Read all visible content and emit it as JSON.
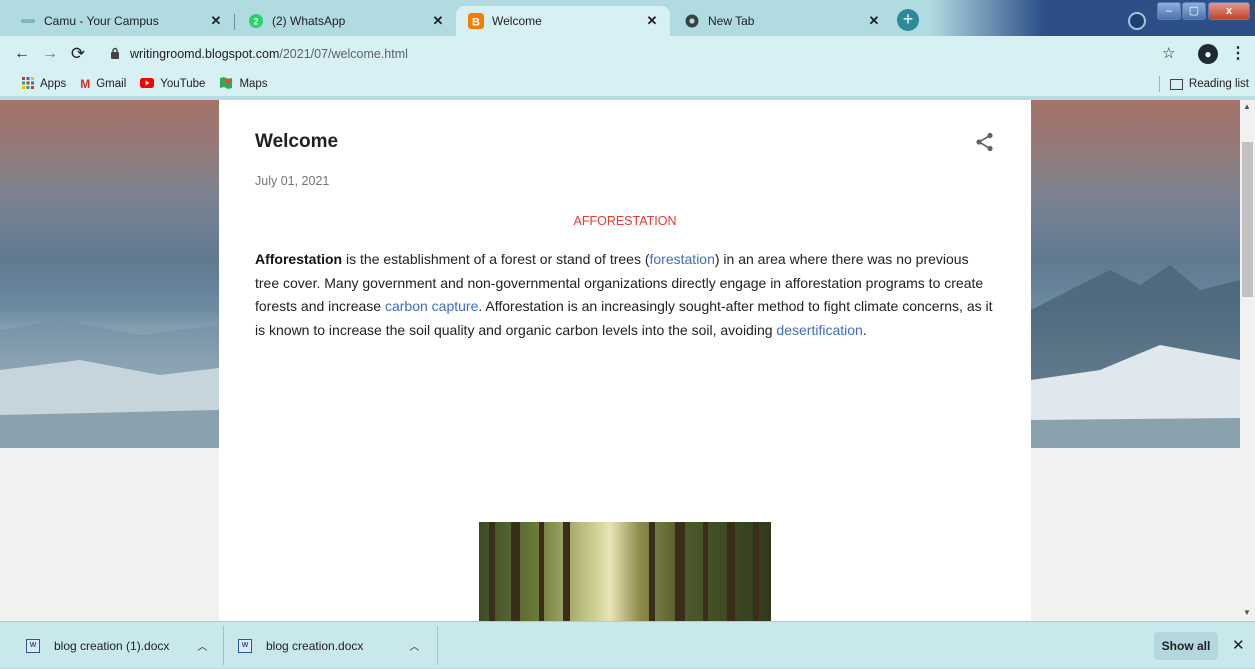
{
  "browser": {
    "tabs": [
      {
        "title": "Camu - Your Campus",
        "favicon": "camu-icon",
        "active": false
      },
      {
        "title": "(2) WhatsApp",
        "favicon": "whatsapp-icon",
        "badge": "2",
        "active": false
      },
      {
        "title": "Welcome",
        "favicon": "blogger-icon",
        "active": true
      },
      {
        "title": "New Tab",
        "favicon": "chrome-icon",
        "active": false
      }
    ],
    "new_tab": "+",
    "window_controls": {
      "minimize": "–",
      "maximize": "▢",
      "close": "x"
    },
    "url_host": "writingroomd.blogspot.com",
    "url_path": "/2021/07/welcome.html",
    "bookmarks": [
      {
        "label": "Apps",
        "icon": "apps-grid-icon",
        "color": "#d93025"
      },
      {
        "label": "Gmail",
        "icon": "gmail-icon",
        "color": "#d93025"
      },
      {
        "label": "YouTube",
        "icon": "youtube-icon",
        "color": "#ff0000"
      },
      {
        "label": "Maps",
        "icon": "maps-icon",
        "color": "#34a853"
      }
    ],
    "reading_list": "Reading list"
  },
  "post": {
    "title": "Welcome",
    "date": "July 01, 2021",
    "subheading": "AFFORESTATION",
    "para_bold": "Afforestation",
    "para_1": " is the establishment of a forest or stand of trees (",
    "link_1": "forestation",
    "para_2": ") in an area where there was no previous tree cover. Many government and non-governmental organizations directly engage in afforestation programs to create forests and increase ",
    "link_2": "carbon capture",
    "para_3": ". Afforestation is an increasingly sought-after method to fight climate concerns, as it is known to increase the soil quality and organic carbon levels into the soil, avoiding ",
    "link_3": "desertification",
    "para_4": "."
  },
  "downloads": {
    "items": [
      {
        "name": "blog creation (1).docx"
      },
      {
        "name": "blog creation.docx"
      }
    ],
    "show_all": "Show all",
    "close": "✕"
  },
  "colors": {
    "accent": "#3f6ec5",
    "subhead_red": "#e53935",
    "frame": "#b0dbe1"
  }
}
